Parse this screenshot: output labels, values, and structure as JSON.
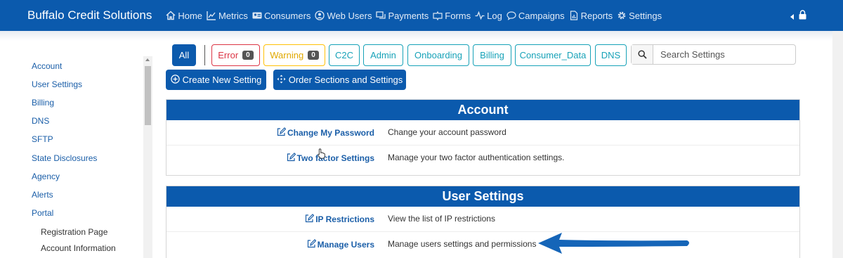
{
  "brand": "Buffalo Credit Solutions",
  "nav": {
    "items": [
      {
        "label": "Home",
        "icon": "home-icon"
      },
      {
        "label": "Metrics",
        "icon": "chart-icon"
      },
      {
        "label": "Consumers",
        "icon": "id-card-icon"
      },
      {
        "label": "Web Users",
        "icon": "user-circle-icon"
      },
      {
        "label": "Payments",
        "icon": "payment-icon"
      },
      {
        "label": "Forms",
        "icon": "forms-icon"
      },
      {
        "label": "Log",
        "icon": "pulse-icon"
      },
      {
        "label": "Campaigns",
        "icon": "chat-icon"
      },
      {
        "label": "Reports",
        "icon": "report-icon"
      },
      {
        "label": "Settings",
        "icon": "gear-icon"
      }
    ]
  },
  "sidebar": {
    "items": [
      "Account",
      "User Settings",
      "Billing",
      "DNS",
      "SFTP",
      "State Disclosures",
      "Agency",
      "Alerts",
      "Portal"
    ],
    "subitems": [
      "Registration Page",
      "Account Information"
    ]
  },
  "filters": {
    "all": "All",
    "error": {
      "label": "Error",
      "count": "0"
    },
    "warning": {
      "label": "Warning",
      "count": "0"
    },
    "tags": [
      "C2C",
      "Admin",
      "Onboarding",
      "Billing",
      "Consumer_Data",
      "DNS"
    ]
  },
  "search": {
    "placeholder": "Search Settings",
    "value": ""
  },
  "actions": {
    "create": "Create New Setting",
    "order": "Order Sections and Settings"
  },
  "sections": [
    {
      "title": "Account",
      "rows": [
        {
          "link": "Change My Password",
          "desc": "Change your account password"
        },
        {
          "link": "Two factor Settings",
          "desc": "Manage your two factor authentication settings."
        }
      ]
    },
    {
      "title": "User Settings",
      "rows": [
        {
          "link": "IP Restrictions",
          "desc": "View the list of IP restrictions"
        },
        {
          "link": "Manage Users",
          "desc": "Manage users settings and permissions"
        }
      ]
    }
  ],
  "colors": {
    "primary": "#0b5aad",
    "error": "#dc3545",
    "warning": "#ffc107",
    "info": "#17a2b8",
    "annotation": "#1565b8"
  }
}
